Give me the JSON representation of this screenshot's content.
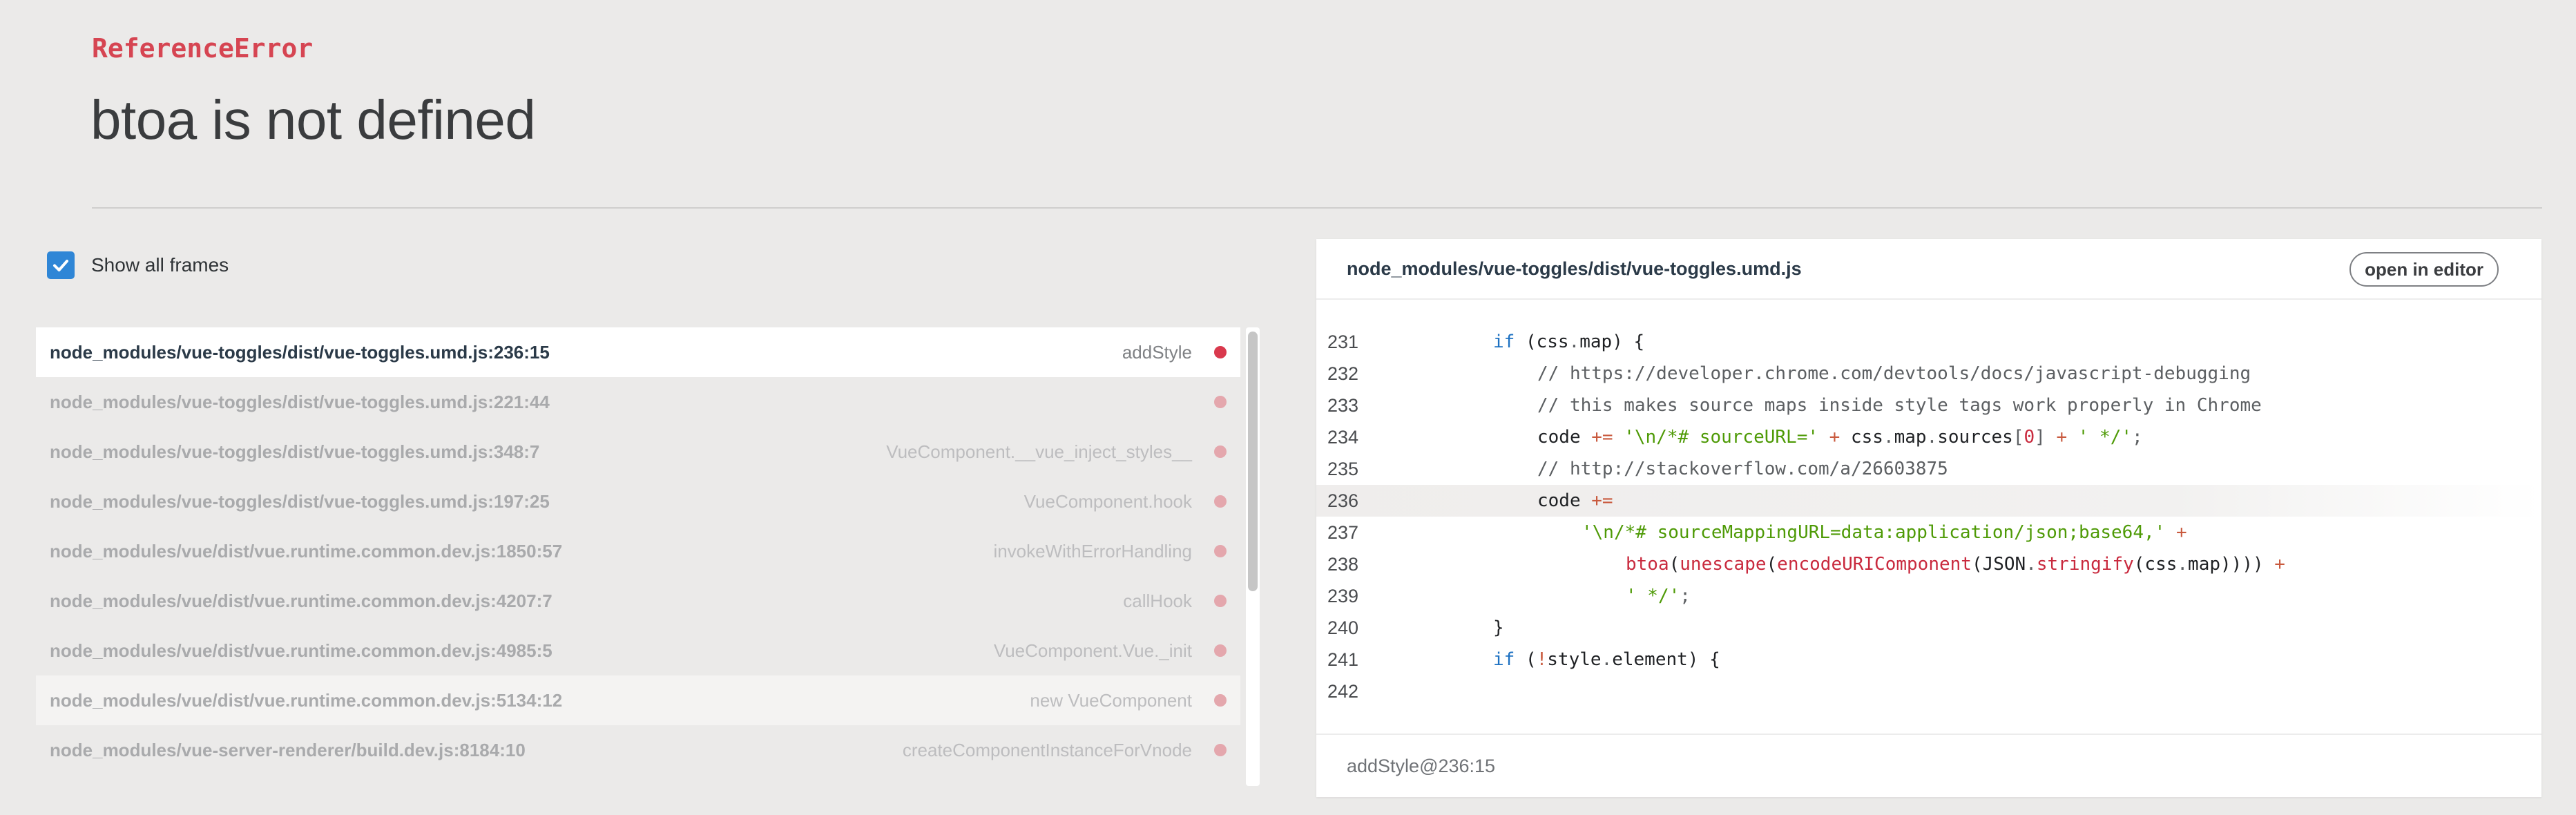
{
  "error": {
    "type": "ReferenceError",
    "message": "btoa is not defined"
  },
  "show_all_frames": {
    "label": "Show all frames",
    "checked": true
  },
  "frames": [
    {
      "file": "node_modules/vue-toggles/dist/vue-toggles.umd.js:236:15",
      "fn": "addStyle"
    },
    {
      "file": "node_modules/vue-toggles/dist/vue-toggles.umd.js:221:44",
      "fn": ""
    },
    {
      "file": "node_modules/vue-toggles/dist/vue-toggles.umd.js:348:7",
      "fn": "VueComponent.__vue_inject_styles__"
    },
    {
      "file": "node_modules/vue-toggles/dist/vue-toggles.umd.js:197:25",
      "fn": "VueComponent.hook"
    },
    {
      "file": "node_modules/vue/dist/vue.runtime.common.dev.js:1850:57",
      "fn": "invokeWithErrorHandling"
    },
    {
      "file": "node_modules/vue/dist/vue.runtime.common.dev.js:4207:7",
      "fn": "callHook"
    },
    {
      "file": "node_modules/vue/dist/vue.runtime.common.dev.js:4985:5",
      "fn": "VueComponent.Vue._init"
    },
    {
      "file": "node_modules/vue/dist/vue.runtime.common.dev.js:5134:12",
      "fn": "new VueComponent"
    },
    {
      "file": "node_modules/vue-server-renderer/build.dev.js:8184:10",
      "fn": "createComponentInstanceForVnode"
    }
  ],
  "code_panel": {
    "file": "node_modules/vue-toggles/dist/vue-toggles.umd.js",
    "open_button": "open in editor",
    "footer": "addStyle@236:15",
    "highlighted_line": "236",
    "lines": [
      {
        "n": "231",
        "indent": 2,
        "tokens": [
          [
            "k",
            "if"
          ],
          [
            "p",
            " ("
          ],
          [
            "p",
            "css"
          ],
          [
            "c",
            "."
          ],
          [
            "p",
            "map"
          ],
          [
            "p",
            ") {"
          ]
        ]
      },
      {
        "n": "232",
        "indent": 3,
        "tokens": [
          [
            "c",
            "// https://developer.chrome.com/devtools/docs/javascript-debugging"
          ]
        ]
      },
      {
        "n": "233",
        "indent": 3,
        "tokens": [
          [
            "c",
            "// this makes source maps inside style tags work properly in Chrome"
          ]
        ]
      },
      {
        "n": "234",
        "indent": 3,
        "tokens": [
          [
            "p",
            "code "
          ],
          [
            "o",
            "+="
          ],
          [
            "p",
            " "
          ],
          [
            "s",
            "'\\n/*# sourceURL='"
          ],
          [
            "p",
            " "
          ],
          [
            "o",
            "+"
          ],
          [
            "p",
            " css"
          ],
          [
            "c",
            "."
          ],
          [
            "p",
            "map"
          ],
          [
            "c",
            "."
          ],
          [
            "p",
            "sources"
          ],
          [
            "c",
            "["
          ],
          [
            "n",
            "0"
          ],
          [
            "c",
            "]"
          ],
          [
            "p",
            " "
          ],
          [
            "o",
            "+"
          ],
          [
            "p",
            " "
          ],
          [
            "s",
            "' */'"
          ],
          [
            "c",
            ";"
          ]
        ]
      },
      {
        "n": "235",
        "indent": 3,
        "tokens": [
          [
            "c",
            "// http://stackoverflow.com/a/26603875"
          ]
        ]
      },
      {
        "n": "236",
        "indent": 3,
        "tokens": [
          [
            "p",
            "code "
          ],
          [
            "o",
            "+="
          ]
        ]
      },
      {
        "n": "237",
        "indent": 4,
        "tokens": [
          [
            "s",
            "'\\n/*# sourceMappingURL=data:application/json;base64,'"
          ],
          [
            "p",
            " "
          ],
          [
            "o",
            "+"
          ]
        ]
      },
      {
        "n": "238",
        "indent": 5,
        "tokens": [
          [
            "f",
            "btoa"
          ],
          [
            "p",
            "("
          ],
          [
            "f",
            "unescape"
          ],
          [
            "p",
            "("
          ],
          [
            "f",
            "encodeURIComponent"
          ],
          [
            "p",
            "(JSON"
          ],
          [
            "c",
            "."
          ],
          [
            "f",
            "stringify"
          ],
          [
            "p",
            "(css"
          ],
          [
            "c",
            "."
          ],
          [
            "p",
            "map)))) "
          ],
          [
            "o",
            "+"
          ]
        ]
      },
      {
        "n": "239",
        "indent": 5,
        "tokens": [
          [
            "s",
            "' */'"
          ],
          [
            "c",
            ";"
          ]
        ]
      },
      {
        "n": "240",
        "indent": 2,
        "tokens": [
          [
            "p",
            "}"
          ]
        ]
      },
      {
        "n": "241",
        "indent": 2,
        "tokens": [
          [
            "k",
            "if"
          ],
          [
            "p",
            " ("
          ],
          [
            "o",
            "!"
          ],
          [
            "p",
            "style"
          ],
          [
            "c",
            "."
          ],
          [
            "p",
            "element) {"
          ]
        ]
      },
      {
        "n": "242",
        "indent": 0,
        "tokens": []
      }
    ]
  },
  "colors": {
    "accent": "#2f86d6",
    "error": "#d64552",
    "frame_dot_active": "#d9394d",
    "frame_dot_inactive": "#e4a7ad"
  },
  "icons": {
    "checkbox": "checkmark-icon",
    "frame_marker": "dot-icon"
  }
}
